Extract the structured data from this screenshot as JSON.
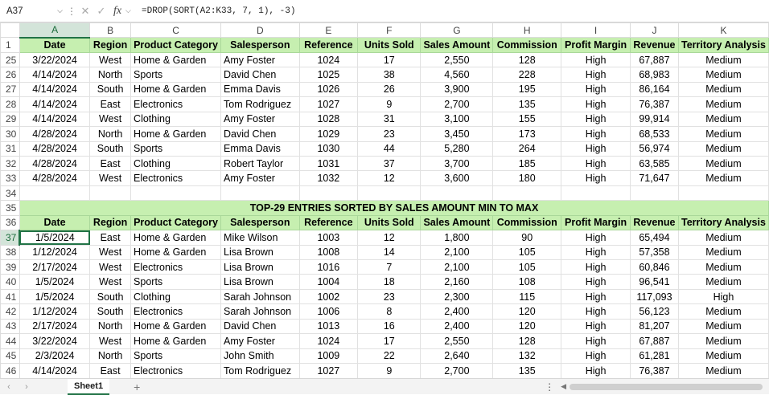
{
  "formula_bar": {
    "name_box": "A37",
    "fx_label": "fx",
    "formula": "=DROP(SORT(A2:K33, 7, 1), -3)"
  },
  "columns": [
    "A",
    "B",
    "C",
    "D",
    "E",
    "F",
    "G",
    "H",
    "I",
    "J",
    "K"
  ],
  "headers": [
    "Date",
    "Region",
    "Product Category",
    "Salesperson",
    "Reference",
    "Units Sold",
    "Sales Amount",
    "Commission",
    "Profit Margin",
    "Revenue",
    "Territory Analysis"
  ],
  "top_rows": [
    {
      "row": "25",
      "cells": [
        "3/22/2024",
        "West",
        "Home & Garden",
        "Amy Foster",
        "1024",
        "17",
        "2,550",
        "128",
        "High",
        "67,887",
        "Medium"
      ]
    },
    {
      "row": "26",
      "cells": [
        "4/14/2024",
        "North",
        "Sports",
        "David Chen",
        "1025",
        "38",
        "4,560",
        "228",
        "High",
        "68,983",
        "Medium"
      ]
    },
    {
      "row": "27",
      "cells": [
        "4/14/2024",
        "South",
        "Home & Garden",
        "Emma Davis",
        "1026",
        "26",
        "3,900",
        "195",
        "High",
        "86,164",
        "Medium"
      ]
    },
    {
      "row": "28",
      "cells": [
        "4/14/2024",
        "East",
        "Electronics",
        "Tom Rodriguez",
        "1027",
        "9",
        "2,700",
        "135",
        "High",
        "76,387",
        "Medium"
      ]
    },
    {
      "row": "29",
      "cells": [
        "4/14/2024",
        "West",
        "Clothing",
        "Amy Foster",
        "1028",
        "31",
        "3,100",
        "155",
        "High",
        "99,914",
        "Medium"
      ]
    },
    {
      "row": "30",
      "cells": [
        "4/28/2024",
        "North",
        "Home & Garden",
        "David Chen",
        "1029",
        "23",
        "3,450",
        "173",
        "High",
        "68,533",
        "Medium"
      ]
    },
    {
      "row": "31",
      "cells": [
        "4/28/2024",
        "South",
        "Sports",
        "Emma Davis",
        "1030",
        "44",
        "5,280",
        "264",
        "High",
        "56,974",
        "Medium"
      ]
    },
    {
      "row": "32",
      "cells": [
        "4/28/2024",
        "East",
        "Clothing",
        "Robert Taylor",
        "1031",
        "37",
        "3,700",
        "185",
        "High",
        "63,585",
        "Medium"
      ]
    },
    {
      "row": "33",
      "cells": [
        "4/28/2024",
        "West",
        "Electronics",
        "Amy Foster",
        "1032",
        "12",
        "3,600",
        "180",
        "High",
        "71,647",
        "Medium"
      ]
    }
  ],
  "blank_row": "34",
  "title_row": {
    "row": "35",
    "text": "TOP-29 ENTRIES SORTED BY SALES AMOUNT MIN TO MAX"
  },
  "header_row_top": "1",
  "header_row_bottom": "36",
  "bottom_rows": [
    {
      "row": "37",
      "cells": [
        "1/5/2024",
        "East",
        "Home & Garden",
        "Mike Wilson",
        "1003",
        "12",
        "1,800",
        "90",
        "High",
        "65,494",
        "Medium"
      ]
    },
    {
      "row": "38",
      "cells": [
        "1/12/2024",
        "West",
        "Home & Garden",
        "Lisa Brown",
        "1008",
        "14",
        "2,100",
        "105",
        "High",
        "57,358",
        "Medium"
      ]
    },
    {
      "row": "39",
      "cells": [
        "2/17/2024",
        "West",
        "Electronics",
        "Lisa Brown",
        "1016",
        "7",
        "2,100",
        "105",
        "High",
        "60,846",
        "Medium"
      ]
    },
    {
      "row": "40",
      "cells": [
        "1/5/2024",
        "West",
        "Sports",
        "Lisa Brown",
        "1004",
        "18",
        "2,160",
        "108",
        "High",
        "96,541",
        "Medium"
      ]
    },
    {
      "row": "41",
      "cells": [
        "1/5/2024",
        "South",
        "Clothing",
        "Sarah Johnson",
        "1002",
        "23",
        "2,300",
        "115",
        "High",
        "117,093",
        "High"
      ]
    },
    {
      "row": "42",
      "cells": [
        "1/12/2024",
        "South",
        "Electronics",
        "Sarah Johnson",
        "1006",
        "8",
        "2,400",
        "120",
        "High",
        "56,123",
        "Medium"
      ]
    },
    {
      "row": "43",
      "cells": [
        "2/17/2024",
        "North",
        "Home & Garden",
        "David Chen",
        "1013",
        "16",
        "2,400",
        "120",
        "High",
        "81,207",
        "Medium"
      ]
    },
    {
      "row": "44",
      "cells": [
        "3/22/2024",
        "West",
        "Home & Garden",
        "Amy Foster",
        "1024",
        "17",
        "2,550",
        "128",
        "High",
        "67,887",
        "Medium"
      ]
    },
    {
      "row": "45",
      "cells": [
        "2/3/2024",
        "North",
        "Sports",
        "John Smith",
        "1009",
        "22",
        "2,640",
        "132",
        "High",
        "61,281",
        "Medium"
      ]
    },
    {
      "row": "46",
      "cells": [
        "4/14/2024",
        "East",
        "Electronics",
        "Tom Rodriguez",
        "1027",
        "9",
        "2,700",
        "135",
        "High",
        "76,387",
        "Medium"
      ]
    }
  ],
  "sheet_tabs": [
    "Sheet1"
  ],
  "colors": {
    "header_fill": "#c6efb0",
    "selection": "#217346"
  }
}
